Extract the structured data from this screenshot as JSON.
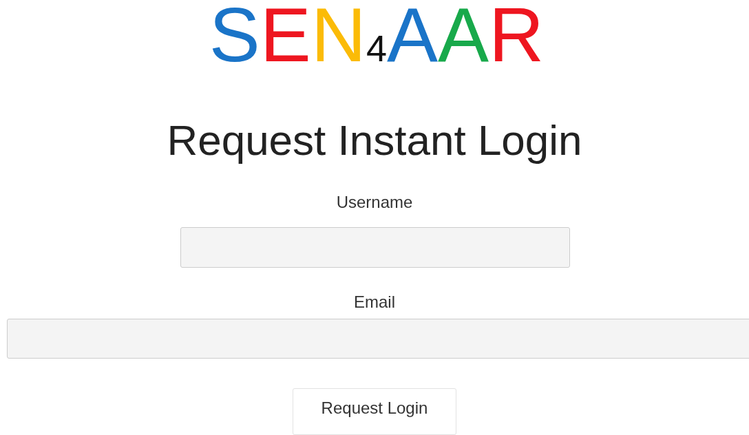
{
  "logo": [
    {
      "text": "S",
      "color": "#1a74c8",
      "kind": "letter"
    },
    {
      "text": "E",
      "color": "#ee1620",
      "kind": "letter"
    },
    {
      "text": "N",
      "color": "#fbbb07",
      "kind": "letter"
    },
    {
      "text": "4",
      "color": "#111111",
      "kind": "sub"
    },
    {
      "text": "A",
      "color": "#1a74c8",
      "kind": "letter"
    },
    {
      "text": "A",
      "color": "#18a94b",
      "kind": "letter"
    },
    {
      "text": "R",
      "color": "#ee1620",
      "kind": "letter"
    }
  ],
  "heading": "Request Instant Login",
  "fields": [
    {
      "label": "Username",
      "kind": "narrow"
    },
    {
      "label": "Email",
      "kind": "wide"
    }
  ],
  "button": "Request Login"
}
